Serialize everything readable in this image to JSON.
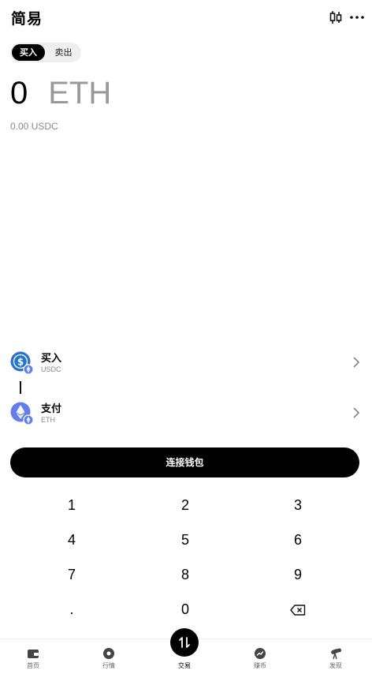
{
  "header": {
    "title": "简易",
    "chart_icon": "candlestick-chart-icon",
    "more_icon": "more-dots-icon"
  },
  "segment": {
    "buy_label": "买入",
    "sell_label": "卖出",
    "selected": "买入"
  },
  "amount": {
    "value": "0",
    "unit": "ETH",
    "converted": "0.00 USDC"
  },
  "route": {
    "buy": {
      "label": "买入",
      "token": "USDC",
      "icon": "usdc-token-icon"
    },
    "pay": {
      "label": "支付",
      "token": "ETH",
      "icon": "eth-token-icon"
    }
  },
  "connect_button": "连接钱包",
  "keypad": {
    "keys": [
      "1",
      "2",
      "3",
      "4",
      "5",
      "6",
      "7",
      "8",
      "9",
      ".",
      "0"
    ],
    "backspace_icon": "backspace-icon"
  },
  "tabbar": {
    "items": [
      {
        "label": "首页",
        "icon": "wallet-icon"
      },
      {
        "label": "行情",
        "icon": "market-icon"
      },
      {
        "label": "交易",
        "icon": "trade-icon"
      },
      {
        "label": "赚币",
        "icon": "earn-icon"
      },
      {
        "label": "发现",
        "icon": "discover-icon"
      }
    ],
    "active": "交易"
  },
  "colors": {
    "primary": "#000000",
    "muted": "#999999",
    "token_blue": "#2775ca",
    "eth_purple": "#627eea"
  }
}
